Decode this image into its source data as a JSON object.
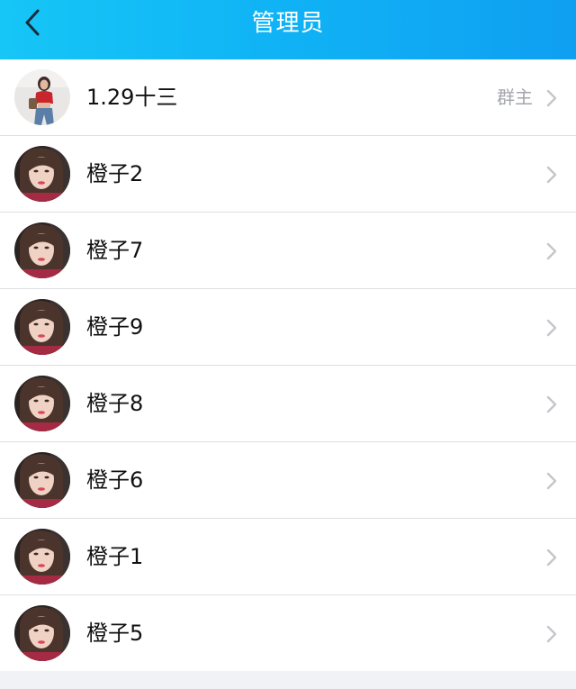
{
  "header": {
    "title": "管理员",
    "back_icon": "back-arrow-icon",
    "background": "#10b4f5"
  },
  "admins": [
    {
      "name": "1.29十三",
      "role": "群主",
      "avatar": "owner-avatar"
    },
    {
      "name": "橙子2",
      "role": "",
      "avatar": "member-avatar"
    },
    {
      "name": "橙子7",
      "role": "",
      "avatar": "member-avatar"
    },
    {
      "name": "橙子9",
      "role": "",
      "avatar": "member-avatar"
    },
    {
      "name": "橙子8",
      "role": "",
      "avatar": "member-avatar"
    },
    {
      "name": "橙子6",
      "role": "",
      "avatar": "member-avatar"
    },
    {
      "name": "橙子1",
      "role": "",
      "avatar": "member-avatar"
    },
    {
      "name": "橙子5",
      "role": "",
      "avatar": "member-avatar"
    }
  ],
  "colors": {
    "name_text": "#111111",
    "role_text": "#a3a6ab",
    "chevron": "#c4c6ca",
    "divider": "#dedfe3"
  }
}
